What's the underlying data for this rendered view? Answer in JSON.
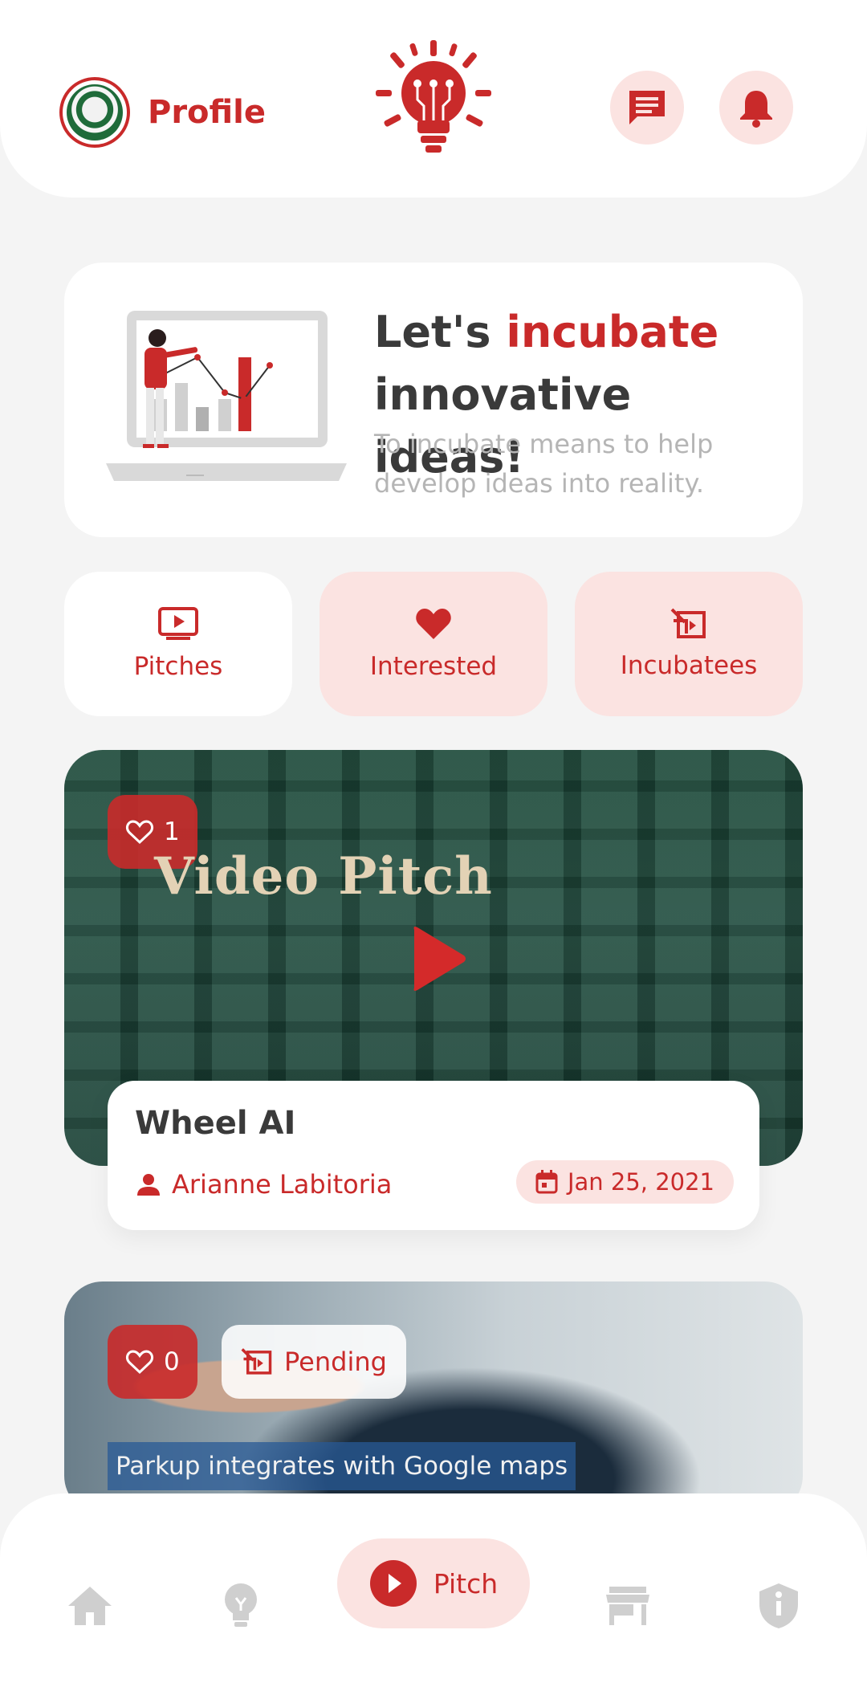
{
  "colors": {
    "accent": "#c92a2a",
    "accent_soft": "#fbe3e1",
    "muted": "#b5b5b5",
    "text": "#3a3a3a"
  },
  "header": {
    "profile_label": "Profile",
    "avatar_icon": "seal-avatar",
    "logo_icon": "lightbulb-sun-logo",
    "messages_icon": "message-icon",
    "notifications_icon": "bell-icon"
  },
  "banner": {
    "title_pre": "Let's ",
    "title_accent": "incubate",
    "title_post": "innovative ideas!",
    "subtitle": "To incubate means to help develop ideas into reality."
  },
  "tabs": [
    {
      "label": "Pitches",
      "icon": "video-icon",
      "active": true
    },
    {
      "label": "Interested",
      "icon": "heart-icon",
      "active": false
    },
    {
      "label": "Incubatees",
      "icon": "incubatee-icon",
      "active": false
    }
  ],
  "pitches": [
    {
      "likes": "1",
      "overlay_text": "Video Pitch",
      "title": "Wheel AI",
      "author": "Arianne Labitoria",
      "date": "Jan 25, 2021"
    },
    {
      "likes": "0",
      "status": "Pending",
      "caption": "Parkup integrates with Google maps"
    }
  ],
  "nav": {
    "items": [
      "home-icon",
      "idea-icon",
      "pitch-icon",
      "store-icon",
      "shield-icon"
    ],
    "active_label": "Pitch"
  }
}
